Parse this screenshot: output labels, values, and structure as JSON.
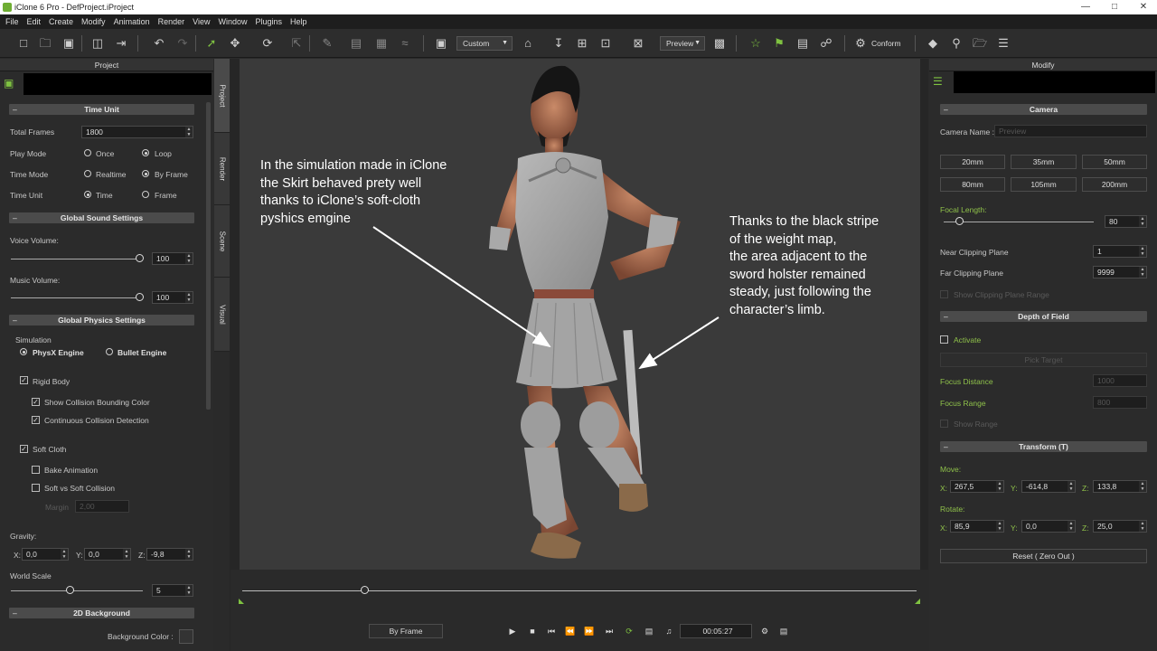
{
  "window": {
    "title": "iClone 6 Pro - DefProject.iProject",
    "min": "—",
    "max": "□",
    "close": "✕"
  },
  "menu": [
    "File",
    "Edit",
    "Create",
    "Modify",
    "Animation",
    "Render",
    "View",
    "Window",
    "Plugins",
    "Help"
  ],
  "toolbar": {
    "view_dropdown": "Custom",
    "preview_dropdown": "Preview",
    "conform_label": "Conform"
  },
  "project": {
    "header": "Project",
    "time_unit": {
      "title": "Time Unit",
      "total_frames_label": "Total Frames",
      "total_frames": "1800",
      "play_mode_label": "Play Mode",
      "once": "Once",
      "loop": "Loop",
      "time_mode_label": "Time Mode",
      "realtime": "Realtime",
      "by_frame": "By Frame",
      "time_unit_label": "Time Unit",
      "time": "Time",
      "frame": "Frame"
    },
    "sound": {
      "title": "Global Sound Settings",
      "voice_label": "Voice Volume:",
      "voice": "100",
      "music_label": "Music Volume:",
      "music": "100"
    },
    "physics": {
      "title": "Global Physics Settings",
      "simulation_label": "Simulation",
      "physx": "PhysX Engine",
      "bullet": "Bullet Engine",
      "rigid_body": "Rigid Body",
      "show_collision": "Show Collision Bounding Color",
      "continuous": "Continuous Collision Detection",
      "soft_cloth": "Soft Cloth",
      "bake_animation": "Bake Animation",
      "soft_vs_soft": "Soft vs Soft Collision",
      "margin_label": "Margin",
      "margin": "2,00",
      "gravity_label": "Gravity:",
      "gx_label": "X:",
      "gx": "0,0",
      "gy_label": "Y:",
      "gy": "0,0",
      "gz_label": "Z:",
      "gz": "-9,8",
      "world_scale_label": "World Scale",
      "world_scale": "5"
    },
    "background": {
      "title": "2D Background",
      "color_label": "Background Color :"
    }
  },
  "tabs": [
    "Project",
    "Render",
    "Scene",
    "Visual"
  ],
  "annotations": {
    "left": [
      "In the simulation made in iClone",
      "the Skirt behaved prety well",
      "thanks to iClone’s soft-cloth",
      "pyshics emgine"
    ],
    "right": [
      "Thanks to the black stripe",
      "of the weight map,",
      "the area adjacent to the",
      "sword holster remained",
      "steady, just following the",
      "character’s limb."
    ]
  },
  "timeline": {
    "mode": "By Frame",
    "time": "00:05:27"
  },
  "modify": {
    "header": "Modify",
    "camera": {
      "title": "Camera",
      "name_label": "Camera Name :",
      "name_placeholder": "Preview",
      "lenses": [
        "20mm",
        "35mm",
        "50mm",
        "80mm",
        "105mm",
        "200mm"
      ],
      "focal_label": "Focal Length:",
      "focal": "80",
      "near_label": "Near Clipping Plane",
      "near": "1",
      "far_label": "Far Clipping Plane",
      "far": "9999",
      "show_clip": "Show Clipping Plane Range"
    },
    "dof": {
      "title": "Depth of Field",
      "activate": "Activate",
      "pick_target": "Pick Target",
      "focus_distance_label": "Focus Distance",
      "focus_distance": "1000",
      "focus_range_label": "Focus Range",
      "focus_range": "800",
      "show_range": "Show Range"
    },
    "transform": {
      "title": "Transform  (T)",
      "move_label": "Move:",
      "mx": "267,5",
      "my": "-614,8",
      "mz": "133,8",
      "rotate_label": "Rotate:",
      "rx": "85,9",
      "ry": "0,0",
      "rz": "25,0",
      "x": "X:",
      "y": "Y:",
      "z": "Z:",
      "reset": "Reset ( Zero Out )"
    }
  },
  "colors": {
    "accent": "#7fc241",
    "panel": "#2b2b2b",
    "viewport": "#3a3a3a"
  }
}
